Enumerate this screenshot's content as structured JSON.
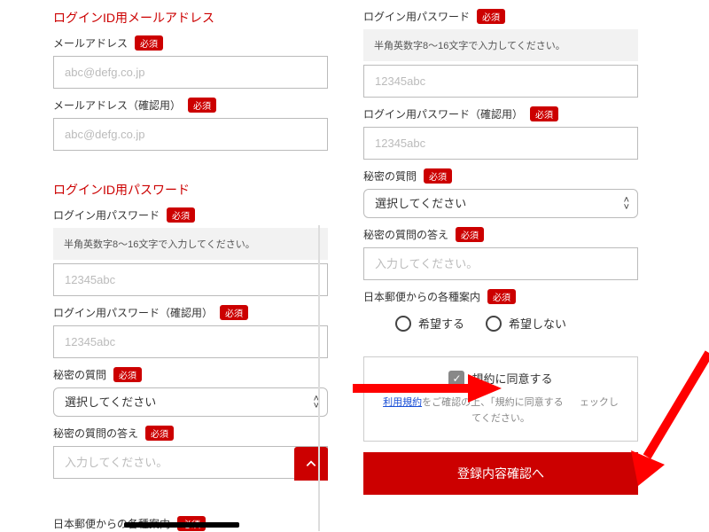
{
  "badges": {
    "required": "必須"
  },
  "left": {
    "sec1_title": "ログインID用メールアドレス",
    "email_label": "メールアドレス",
    "email_ph": "abc@defg.co.jp",
    "email_conf_label": "メールアドレス（確認用）",
    "sec2_title": "ログインID用パスワード",
    "pw_label": "ログイン用パスワード",
    "pw_note": "半角英数字8〜16文字で入力してください。",
    "pw_ph": "12345abc",
    "pw_conf_label": "ログイン用パスワード（確認用）",
    "secret_q_label": "秘密の質問",
    "secret_q_ph": "選択してください",
    "secret_a_label": "秘密の質問の答え",
    "secret_a_ph": "入力してください。",
    "guide_label": "日本郵便からの各種案内"
  },
  "right": {
    "pw_label": "ログイン用パスワード",
    "pw_note": "半角英数字8〜16文字で入力してください。",
    "pw_ph": "12345abc",
    "pw_conf_label": "ログイン用パスワード（確認用）",
    "secret_q_label": "秘密の質問",
    "secret_q_ph": "選択してください",
    "secret_a_label": "秘密の質問の答え",
    "secret_a_ph": "入力してください。",
    "guide_label": "日本郵便からの各種案内",
    "opt_yes": "希望する",
    "opt_no": "希望しない",
    "agree_label": "規約に同意する",
    "agree_link": "利用規約",
    "agree_note_1": "をご確認の上、「規約に同意する",
    "agree_note_2": "ェックしてください。",
    "submit": "登録内容確認へ"
  }
}
